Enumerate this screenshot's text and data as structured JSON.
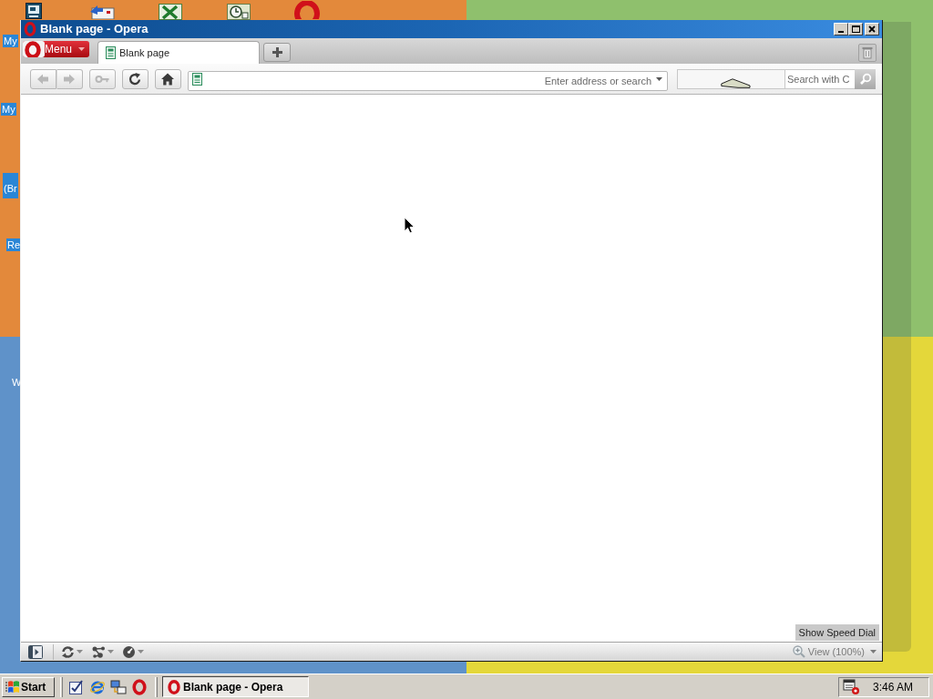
{
  "desktop": {
    "icon_labels": [
      "My",
      "My",
      "(Br",
      "Re",
      "W"
    ]
  },
  "window": {
    "title": "Blank page - Opera",
    "menu_label": "Menu"
  },
  "tabs": [
    {
      "label": "Blank page",
      "selected": true
    }
  ],
  "toolbar": {
    "nav_buttons": [
      {
        "kind": "back",
        "disabled": true
      },
      {
        "kind": "forward",
        "disabled": true
      },
      {
        "kind": "key",
        "disabled": true
      },
      {
        "kind": "reload",
        "disabled": false
      },
      {
        "kind": "home",
        "disabled": false
      }
    ],
    "address": {
      "placeholder": "Enter address or search"
    },
    "search": {
      "placeholder": "Search with C"
    }
  },
  "page": {
    "speed_dial_button": "Show Speed Dial"
  },
  "status_bar": {
    "zoom": "View (100%)"
  },
  "taskbar": {
    "start": "Start",
    "tasks": [
      {
        "label": "Blank page - Opera",
        "selected": true
      }
    ],
    "clock": "3:46 AM"
  }
}
